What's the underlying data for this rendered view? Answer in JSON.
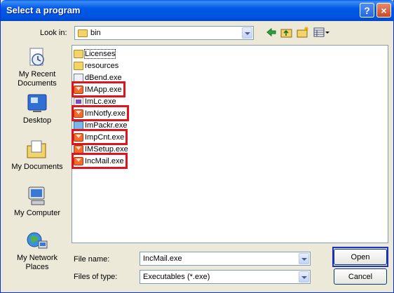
{
  "window": {
    "title": "Select a program",
    "help_glyph": "?",
    "close_glyph": "×"
  },
  "toolbar": {
    "look_in_label": "Look in:",
    "look_in_value": "bin",
    "back_icon": "back-arrow-icon",
    "up_icon": "up-folder-icon",
    "new_folder_icon": "new-folder-icon",
    "view_icon": "view-menu-icon"
  },
  "places": [
    {
      "label": "My Recent\nDocuments",
      "icon": "recent-documents-icon"
    },
    {
      "label": "Desktop",
      "icon": "desktop-icon"
    },
    {
      "label": "My Documents",
      "icon": "my-documents-icon"
    },
    {
      "label": "My Computer",
      "icon": "my-computer-icon"
    },
    {
      "label": "My Network\nPlaces",
      "icon": "network-places-icon"
    }
  ],
  "files": [
    {
      "name": "Licenses",
      "type": "folder",
      "highlighted": false
    },
    {
      "name": "resources",
      "type": "folder",
      "highlighted": false
    },
    {
      "name": "dBend.exe",
      "type": "exe",
      "highlighted": false
    },
    {
      "name": "IMApp.exe",
      "type": "envelope",
      "highlighted": true
    },
    {
      "name": "ImLc.exe",
      "type": "app",
      "highlighted": false
    },
    {
      "name": "ImNotfy.exe",
      "type": "envelope",
      "highlighted": true
    },
    {
      "name": "ImPackr.exe",
      "type": "pack",
      "highlighted": false
    },
    {
      "name": "ImpCnt.exe",
      "type": "envelope",
      "highlighted": true
    },
    {
      "name": "IMSetup.exe",
      "type": "envelope",
      "highlighted": false
    },
    {
      "name": "IncMail.exe",
      "type": "envelope",
      "highlighted": true
    }
  ],
  "form": {
    "file_name_label": "File name:",
    "file_name_value": "IncMail.exe",
    "file_type_label": "Files of type:",
    "file_type_value": "Executables (*.exe)"
  },
  "buttons": {
    "open": "Open",
    "cancel": "Cancel"
  },
  "colors": {
    "highlight": "#e0141e",
    "focus_frame": "#1f2fc8"
  }
}
